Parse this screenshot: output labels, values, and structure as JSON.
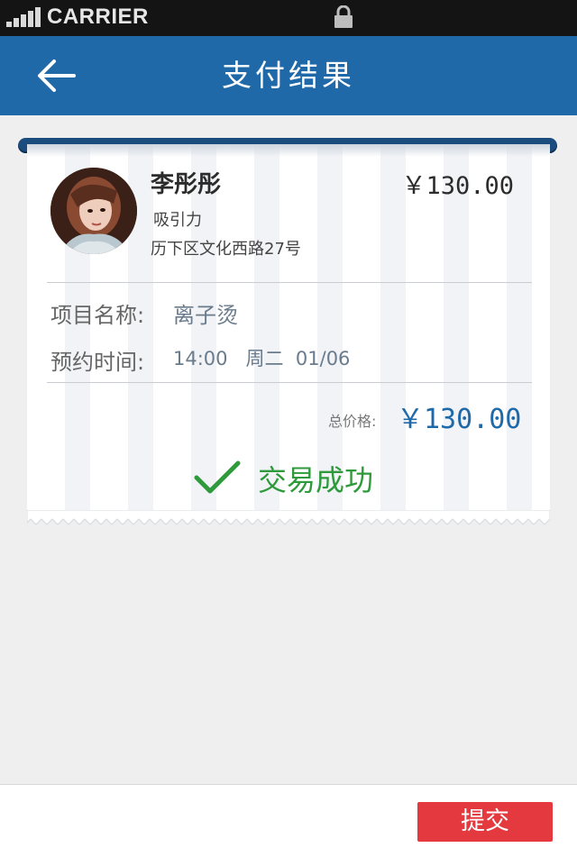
{
  "status_bar": {
    "carrier": "CARRIER",
    "signal_icon": "signal-bars-icon",
    "lock_icon": "lock-icon"
  },
  "nav": {
    "title": "支付结果",
    "back_icon": "back-arrow-icon"
  },
  "order": {
    "stylist_name": "李彤彤",
    "stylist_price": "￥130.00",
    "salon_name": "吸引力",
    "salon_address": "历下区文化西路27号",
    "service_label": "项目名称:",
    "service_value": "离子烫",
    "time_label": "预约时间:",
    "time_value": "14:00   周二  01/06",
    "total_label": "总价格:",
    "total_value": "￥130.00"
  },
  "result": {
    "status_text": "交易成功",
    "status_icon": "checkmark-icon"
  },
  "footer": {
    "submit_label": "提交"
  },
  "colors": {
    "nav_blue": "#1f69a9",
    "success_green": "#2f9a3c",
    "submit_red": "#e4393f",
    "price_blue": "#1f69a9"
  }
}
